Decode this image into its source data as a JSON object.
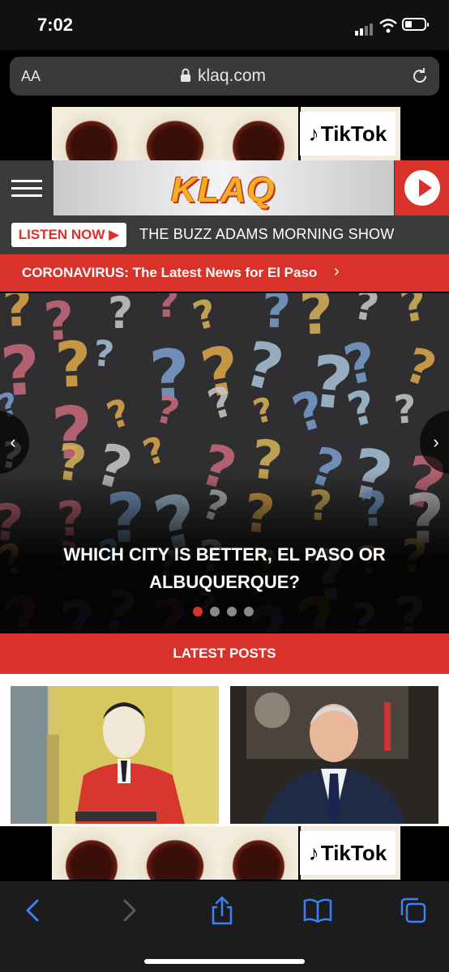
{
  "status_bar": {
    "time": "7:02"
  },
  "browser": {
    "text_size_label": "AA",
    "url": "klaq.com"
  },
  "ad": {
    "brand": "TikTok"
  },
  "header": {
    "logo": "KLAQ"
  },
  "listen": {
    "button_label": "LISTEN NOW ▶",
    "show_name": "THE BUZZ ADAMS MORNING SHOW"
  },
  "banner": {
    "text": "CORONAVIRUS: The Latest News for El Paso",
    "chevron": "›"
  },
  "hero": {
    "title": "WHICH CITY IS BETTER, EL PASO OR ALBUQUERQUE?",
    "slide_count": 4,
    "active_slide": 1,
    "prev": "‹",
    "next": "›"
  },
  "latest": {
    "title": "LATEST POSTS"
  },
  "colors": {
    "accent": "#d9322b",
    "header_bg": "#3b3b3b"
  }
}
